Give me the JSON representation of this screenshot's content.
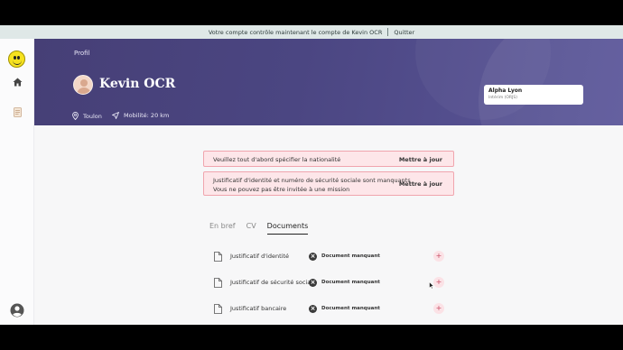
{
  "banner": {
    "message": "Votre compte contrôle maintenant le compte de Kevin OCR",
    "quit_label": "Quitter"
  },
  "sidebar": {
    "items": [
      {
        "icon": "smiley-logo-icon"
      },
      {
        "icon": "home-icon"
      },
      {
        "icon": "document-icon"
      },
      {
        "icon": "user-account-icon"
      }
    ]
  },
  "header": {
    "breadcrumb": "Profil",
    "name": "Kevin OCR",
    "city": "Toulon",
    "mobility": "Mobilité: 20 km",
    "agency": {
      "name": "Alpha Lyon",
      "subtitle": "Intérim (ORJS)"
    }
  },
  "alerts": [
    {
      "line1": "Veuillez tout d'abord spécifier la nationalité",
      "line2": "",
      "action": "Mettre à jour"
    },
    {
      "line1": "Justificatif d'identité et numéro de sécurité sociale sont manquants",
      "line2": "Vous ne pouvez pas être invitée à une mission",
      "action": "Mettre à jour"
    }
  ],
  "tabs": [
    {
      "label": "En bref",
      "active": false
    },
    {
      "label": "CV",
      "active": false
    },
    {
      "label": "Documents",
      "active": true
    }
  ],
  "documents": [
    {
      "name": "Justificatif d'identité",
      "status": "Document manquant",
      "add": "+"
    },
    {
      "name": "Justificatif de sécurité sociale",
      "status": "Document manquant",
      "add": "+"
    },
    {
      "name": "Justificatif bancaire",
      "status": "Document manquant",
      "add": "+"
    }
  ],
  "colors": {
    "header": "#4b4682",
    "alert_bg": "#fde6e9",
    "alert_border": "#f0a5ae",
    "banner_bg": "#dfe8e7"
  }
}
